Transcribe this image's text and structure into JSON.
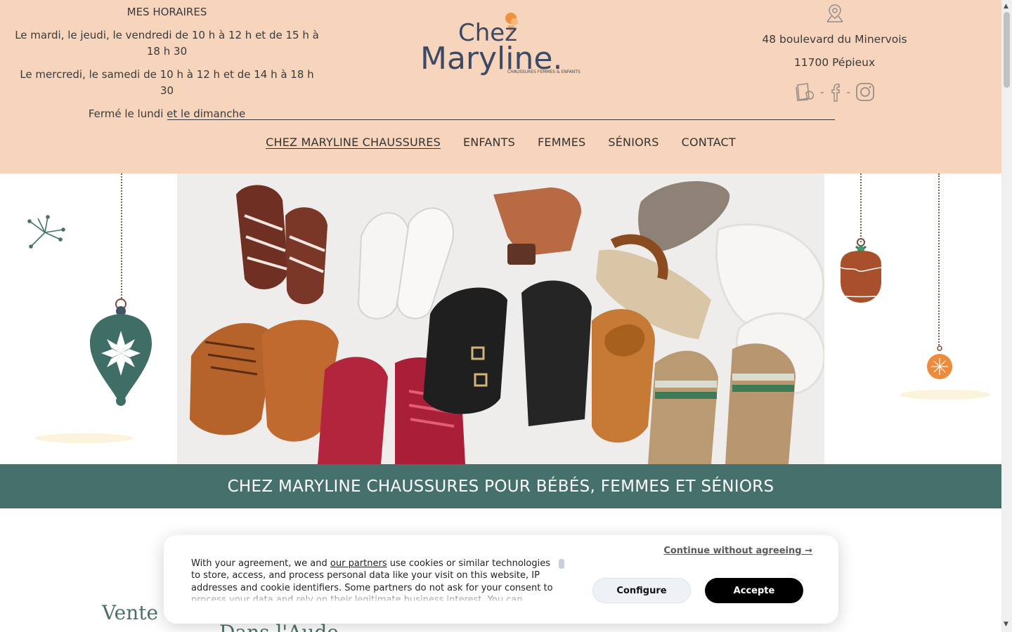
{
  "hours": {
    "title": "MES HORAIRES",
    "line1": "Le mardi, le jeudi, le vendredi de 10 h à 12 h et de 15 h à 18 h 30",
    "line2": "Le mercredi, le samedi de 10 h à 12 h et de 14 h à 18 h 30",
    "line3": "Fermé le lundi et le dimanche"
  },
  "logo": {
    "word1": "Chez",
    "word2": "Maryline.",
    "tagline": "CHAUSSURES FEMMES & ENFANTS"
  },
  "address": {
    "street": "48 boulevard du Minervois",
    "city": "11700 Pépieux",
    "separator": "-",
    "icons": [
      "location-pin-icon",
      "pagesjaunes-icon",
      "facebook-icon",
      "instagram-icon"
    ]
  },
  "nav": {
    "items": [
      {
        "label": "CHEZ MARYLINE CHAUSSURES",
        "active": true
      },
      {
        "label": "ENFANTS"
      },
      {
        "label": "FEMMES"
      },
      {
        "label": "SÉNIORS"
      },
      {
        "label": "CONTACT"
      }
    ]
  },
  "banner": {
    "title": "CHEZ MARYLINE CHAUSSURES POUR BÉBÉS, FEMMES ET SÉNIORS"
  },
  "below": {
    "word1": "Vente",
    "word2": "Dans l'Aude"
  },
  "cookie": {
    "text_before_link": "With your agreement, we and ",
    "link": "our partners",
    "text_after_link": " use cookies or similar technologies to store, access, and process personal data like your visit on this website, IP addresses and cookie identifiers. Some partners do not ask for your consent to process your data and rely on their legitimate business interest. You can",
    "continue": "Continue without agreeing →",
    "configure": "Configure",
    "accept": "Accepte"
  },
  "colors": {
    "header_bg": "#f7d4bc",
    "banner_bg": "#46706b",
    "accent_orange": "#a8502b",
    "accent_green": "#3f6e66"
  }
}
